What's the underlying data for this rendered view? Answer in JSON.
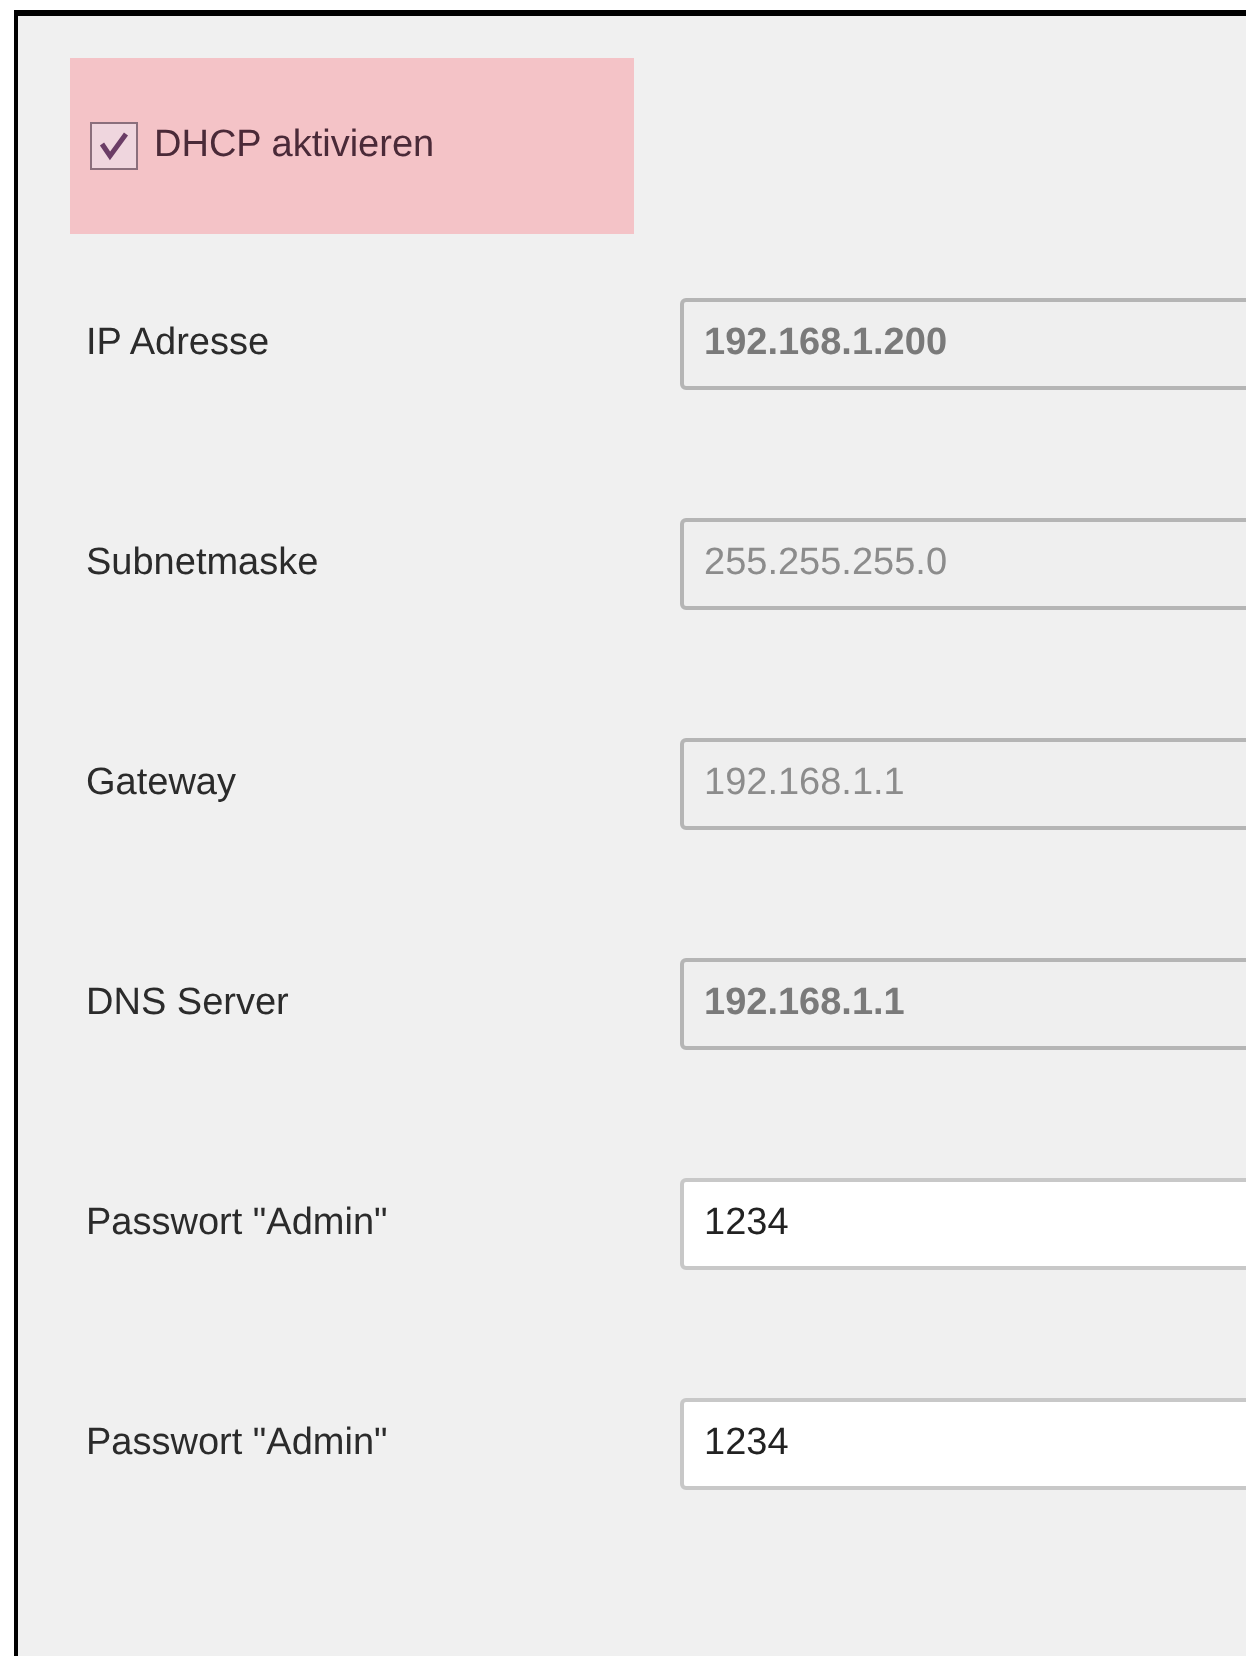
{
  "dhcp": {
    "label": "DHCP aktivieren",
    "checked": true,
    "highlighted": true
  },
  "fields": [
    {
      "label": "IP Adresse",
      "value": "192.168.1.200",
      "kind": "auto"
    },
    {
      "label": "Subnetmaske",
      "value": "255.255.255.0",
      "kind": "disabled"
    },
    {
      "label": "Gateway",
      "value": "192.168.1.1",
      "kind": "disabled"
    },
    {
      "label": "DNS Server",
      "value": "192.168.1.1",
      "kind": "auto"
    },
    {
      "label": "Passwort \"Admin\"",
      "value": "1234",
      "kind": "editable"
    },
    {
      "label": "Passwort \"Admin\"",
      "value": "1234",
      "kind": "editable"
    }
  ]
}
